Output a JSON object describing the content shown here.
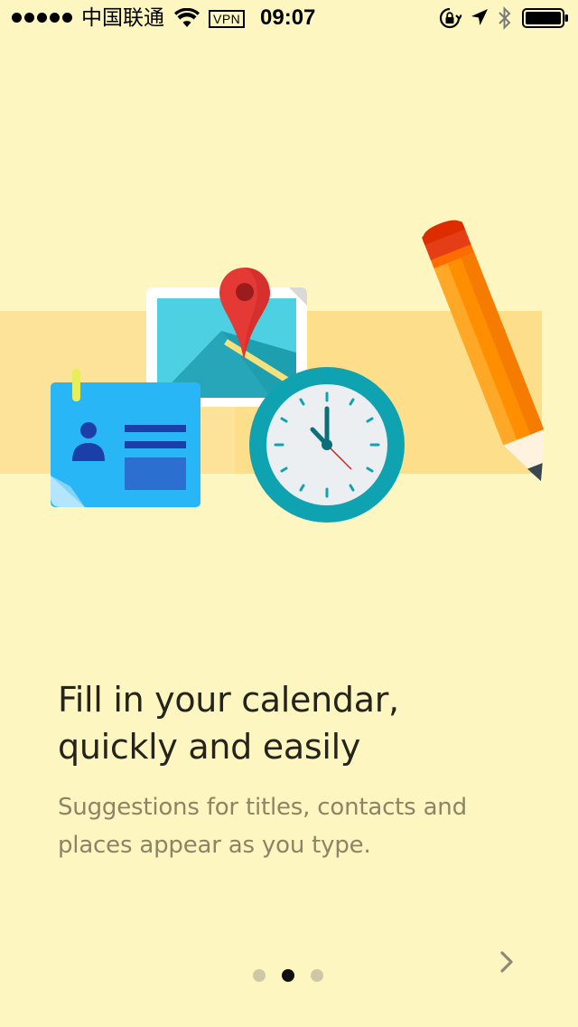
{
  "status_bar": {
    "carrier": "中国联通",
    "vpn": "VPN",
    "time": "09:07",
    "signal_bars": 5,
    "battery_level": 1.0
  },
  "onboarding": {
    "headline": "Fill in your calendar, quickly and easily",
    "description": "Suggestions for titles, contacts and places appear as you type.",
    "page_count": 3,
    "current_page": 2,
    "next_icon": "chevron-right-icon"
  },
  "illustration": {
    "items": [
      "contact-card",
      "map-with-pin",
      "clock",
      "pencil"
    ],
    "colors": {
      "background": "#fef6c1",
      "band": "#fde39a",
      "card_blue": "#29b6f6",
      "map_teal": "#26c6da",
      "pin_red": "#e53935",
      "clock_ring": "#0fa3b1",
      "pencil_orange": "#ff8f00"
    }
  }
}
